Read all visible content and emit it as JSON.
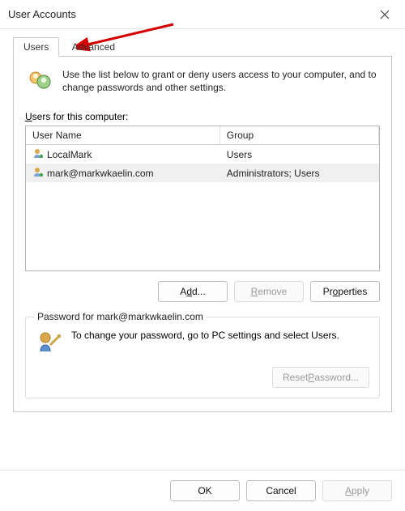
{
  "window": {
    "title": "User Accounts"
  },
  "tabs": {
    "users": "Users",
    "advanced": "Advanced"
  },
  "intro": "Use the list below to grant or deny users access to your computer, and to change passwords and other settings.",
  "users_section": {
    "label_prefix": "U",
    "label_rest": "sers for this computer:",
    "columns": {
      "name": "User Name",
      "group": "Group"
    },
    "rows": [
      {
        "name": "LocalMark",
        "group": "Users",
        "selected": false
      },
      {
        "name": "mark@markwkaelin.com",
        "group": "Administrators; Users",
        "selected": true
      }
    ],
    "buttons": {
      "add": "Add...",
      "remove": "Remove",
      "properties": "Properties"
    }
  },
  "password_section": {
    "legend": "Password for mark@markwkaelin.com",
    "text": "To change your password, go to PC settings and select Users.",
    "reset": "Reset Password..."
  },
  "footer": {
    "ok": "OK",
    "cancel": "Cancel",
    "apply": "Apply"
  }
}
